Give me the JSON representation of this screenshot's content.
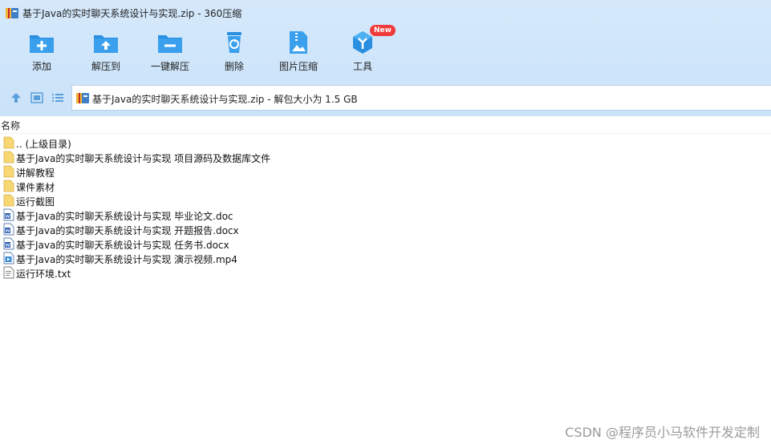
{
  "window": {
    "title": "基于Java的实时聊天系统设计与实现.zip - 360压缩"
  },
  "toolbar": {
    "items": [
      {
        "label": "添加",
        "icon": "add-folder-icon"
      },
      {
        "label": "解压到",
        "icon": "extract-to-icon"
      },
      {
        "label": "一键解压",
        "icon": "one-click-extract-icon"
      },
      {
        "label": "删除",
        "icon": "recycle-bin-icon"
      },
      {
        "label": "图片压缩",
        "icon": "image-compress-icon"
      },
      {
        "label": "工具",
        "icon": "tools-icon",
        "badge": "New"
      }
    ]
  },
  "address": {
    "text": "基于Java的实时聊天系统设计与实现.zip - 解包大小为 1.5 GB"
  },
  "list": {
    "header_name": "名称",
    "items": [
      {
        "label": ".. (上级目录)",
        "icon": "folder-icon"
      },
      {
        "label": "基于Java的实时聊天系统设计与实现 项目源码及数据库文件",
        "icon": "folder-icon"
      },
      {
        "label": "讲解教程",
        "icon": "folder-icon"
      },
      {
        "label": "课件素材",
        "icon": "folder-icon"
      },
      {
        "label": "运行截图",
        "icon": "folder-icon"
      },
      {
        "label": "基于Java的实时聊天系统设计与实现 毕业论文.doc",
        "icon": "word-doc-icon"
      },
      {
        "label": "基于Java的实时聊天系统设计与实现 开题报告.docx",
        "icon": "word-doc-icon"
      },
      {
        "label": "基于Java的实时聊天系统设计与实现 任务书.docx",
        "icon": "word-doc-icon"
      },
      {
        "label": "基于Java的实时聊天系统设计与实现 演示视频.mp4",
        "icon": "video-file-icon"
      },
      {
        "label": "运行环境.txt",
        "icon": "text-file-icon"
      }
    ]
  },
  "watermark": "CSDN @程序员小马软件开发定制",
  "colors": {
    "chrome_bg": "#cfe5fa",
    "icon_blue": "#2b8fe0",
    "folder_yellow": "#f7d774",
    "badge_red": "#ef3b3b"
  }
}
